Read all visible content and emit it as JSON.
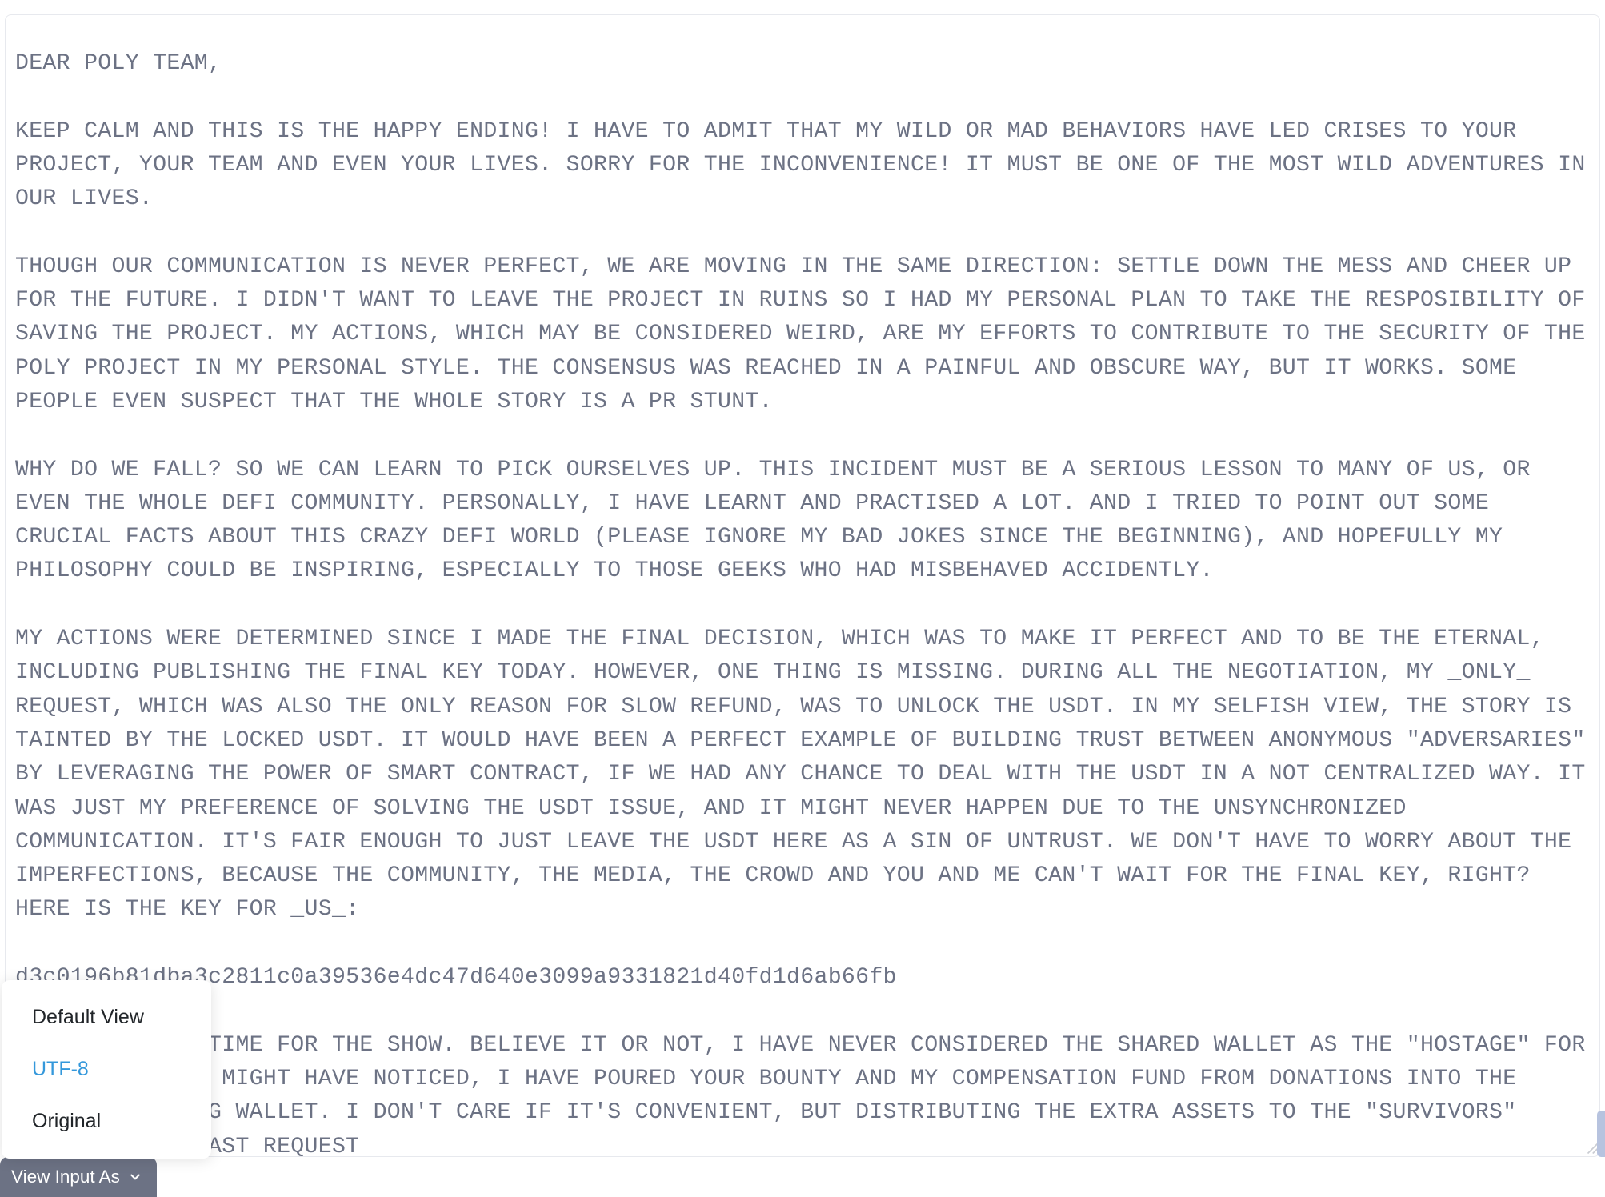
{
  "message": {
    "body": "DEAR POLY TEAM,\n\nKEEP CALM AND THIS IS THE HAPPY ENDING! I HAVE TO ADMIT THAT MY WILD OR MAD BEHAVIORS HAVE LED CRISES TO YOUR PROJECT, YOUR TEAM AND EVEN YOUR LIVES. SORRY FOR THE INCONVENIENCE! IT MUST BE ONE OF THE MOST WILD ADVENTURES IN OUR LIVES.\n\nTHOUGH OUR COMMUNICATION IS NEVER PERFECT, WE ARE MOVING IN THE SAME DIRECTION: SETTLE DOWN THE MESS AND CHEER UP FOR THE FUTURE. I DIDN'T WANT TO LEAVE THE PROJECT IN RUINS SO I HAD MY PERSONAL PLAN TO TAKE THE RESPOSIBILITY OF SAVING THE PROJECT. MY ACTIONS, WHICH MAY BE CONSIDERED WEIRD, ARE MY EFFORTS TO CONTRIBUTE TO THE SECURITY OF THE POLY PROJECT IN MY PERSONAL STYLE. THE CONSENSUS WAS REACHED IN A PAINFUL AND OBSCURE WAY, BUT IT WORKS. SOME PEOPLE EVEN SUSPECT THAT THE WHOLE STORY IS A PR STUNT.\n\nWHY DO WE FALL? SO WE CAN LEARN TO PICK OURSELVES UP. THIS INCIDENT MUST BE A SERIOUS LESSON TO MANY OF US, OR EVEN THE WHOLE DEFI COMMUNITY. PERSONALLY, I HAVE LEARNT AND PRACTISED A LOT. AND I TRIED TO POINT OUT SOME CRUCIAL FACTS ABOUT THIS CRAZY DEFI WORLD (PLEASE IGNORE MY BAD JOKES SINCE THE BEGINNING), AND HOPEFULLY MY PHILOSOPHY COULD BE INSPIRING, ESPECIALLY TO THOSE GEEKS WHO HAD MISBEHAVED ACCIDENTLY.\n\nMY ACTIONS WERE DETERMINED SINCE I MADE THE FINAL DECISION, WHICH WAS TO MAKE IT PERFECT AND TO BE THE ETERNAL, INCLUDING PUBLISHING THE FINAL KEY TODAY. HOWEVER, ONE THING IS MISSING. DURING ALL THE NEGOTIATION, MY _ONLY_ REQUEST, WHICH WAS ALSO THE ONLY REASON FOR SLOW REFUND, WAS TO UNLOCK THE USDT. IN MY SELFISH VIEW, THE STORY IS TAINTED BY THE LOCKED USDT. IT WOULD HAVE BEEN A PERFECT EXAMPLE OF BUILDING TRUST BETWEEN ANONYMOUS \"ADVERSARIES\" BY LEVERAGING THE POWER OF SMART CONTRACT, IF WE HAD ANY CHANCE TO DEAL WITH THE USDT IN A NOT CENTRALIZED WAY. IT WAS JUST MY PREFERENCE OF SOLVING THE USDT ISSUE, AND IT MIGHT NEVER HAPPEN DUE TO THE UNSYNCHRONIZED COMMUNICATION. IT'S FAIR ENOUGH TO JUST LEAVE THE USDT HERE AS A SIN OF UNTRUST. WE DON'T HAVE TO WORRY ABOUT THE IMPERFECTIONS, BECAUSE THE COMMUNITY, THE MEDIA, THE CROWD AND YOU AND ME CAN'T WAIT FOR THE FINAL KEY, RIGHT? HERE IS THE KEY FOR _US_:\n\nd3c0196b81dba3c2811c0a39536e4dc47d640e3099a9331821d40fd1d6ab66fb\n\nBTW IT'S TIME TIME FOR THE SHOW. BELIEVE IT OR NOT, I HAVE NEVER CONSIDERED THE SHARED WALLET AS THE \"HOSTAGE\" FOR RANSOM. AS YOU MIGHT HAVE NOTICED, I HAVE POURED YOUR BOUNTY AND MY COMPENSATION FUND FROM DONATIONS INTO THE SHARED MULTISIG WALLET. I DON'T CARE IF IT'S CONVENIENT, BUT DISTRIBUTING THE EXTRA ASSETS TO THE \"SURVIVORS\" WOULD BE THE LAST REQUEST"
  },
  "dropdown": {
    "items": [
      {
        "label": "Default View",
        "active": false
      },
      {
        "label": "UTF-8",
        "active": true
      },
      {
        "label": "Original",
        "active": false
      }
    ]
  },
  "button": {
    "label": "View Input As"
  }
}
